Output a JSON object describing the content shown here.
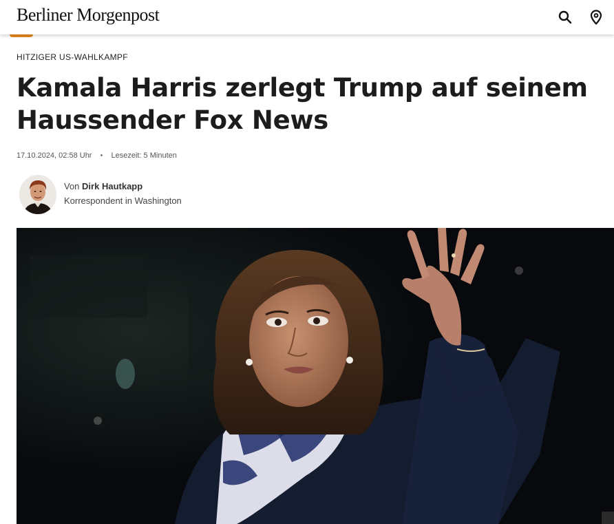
{
  "header": {
    "logo_text": "Berliner Morgenpost",
    "search_icon": "search-icon",
    "location_icon": "location-pin-icon",
    "accent_color": "#e8891b"
  },
  "article": {
    "kicker": "HITZIGER US-WAHLKAMPF",
    "headline": "Kamala Harris zerlegt Trump auf seinem Haussender Fox News",
    "date": "17.10.2024, 02:58 Uhr",
    "reading_time": "Lesezeit: 5 Minuten",
    "author": {
      "prefix": "Von",
      "name": "Dirk Hautkapp",
      "role": "Korrespondent in Washington"
    }
  }
}
